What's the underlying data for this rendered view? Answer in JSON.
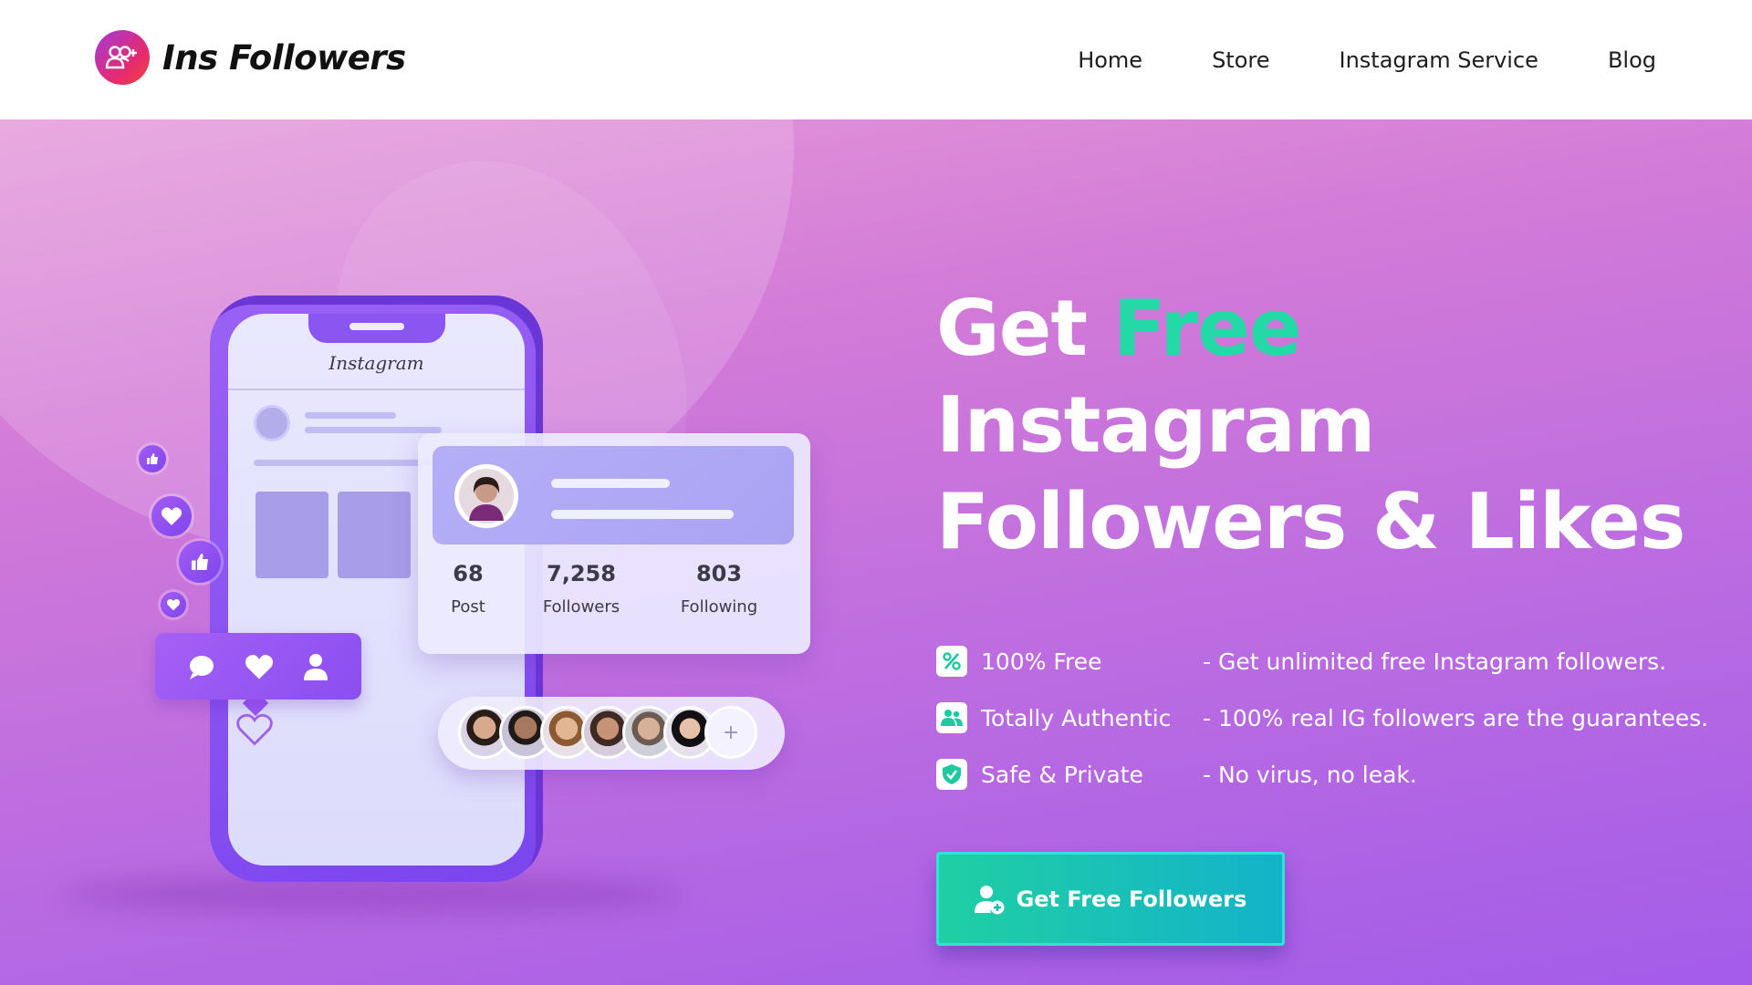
{
  "brand": {
    "name": "Ins Followers",
    "logo_icon": "add-user-group-icon",
    "logo_gradient": [
      "#a23bd9",
      "#e62a6e",
      "#f2453a"
    ]
  },
  "nav": {
    "items": [
      {
        "label": "Home"
      },
      {
        "label": "Store"
      },
      {
        "label": "Instagram Service"
      },
      {
        "label": "Blog"
      }
    ]
  },
  "hero": {
    "headline": {
      "word1": "Get",
      "accent": "Free",
      "line2": "Instagram",
      "line3": "Followers & Likes"
    },
    "accent_color": "#23d9a5",
    "background_colors": [
      "#e59ad9",
      "#bd6de0",
      "#a35ce9"
    ],
    "features": [
      {
        "icon": "percent-icon",
        "title": "100% Free",
        "description": "- Get unlimited free Instagram followers."
      },
      {
        "icon": "users-icon",
        "title": "Totally Authentic",
        "description": "- 100% real IG followers are the guarantees."
      },
      {
        "icon": "shield-check-icon",
        "title": "Safe & Private",
        "description": "- No virus, no leak."
      }
    ],
    "cta": {
      "label": "Get Free Followers",
      "icon": "add-user-icon",
      "colors": [
        "#20cfa3",
        "#13b3c9"
      ]
    }
  },
  "illustration": {
    "phone_app_label": "Instagram",
    "profile_stats": [
      {
        "value": "68",
        "label": "Post"
      },
      {
        "value": "7,258",
        "label": "Followers"
      },
      {
        "value": "803",
        "label": "Following"
      }
    ],
    "follower_strip_more": "+",
    "reaction_icons": [
      "thumbs-up-icon",
      "heart-icon",
      "thumbs-up-icon",
      "heart-icon"
    ],
    "action_icons": [
      "comment-icon",
      "heart-icon",
      "user-icon"
    ]
  }
}
